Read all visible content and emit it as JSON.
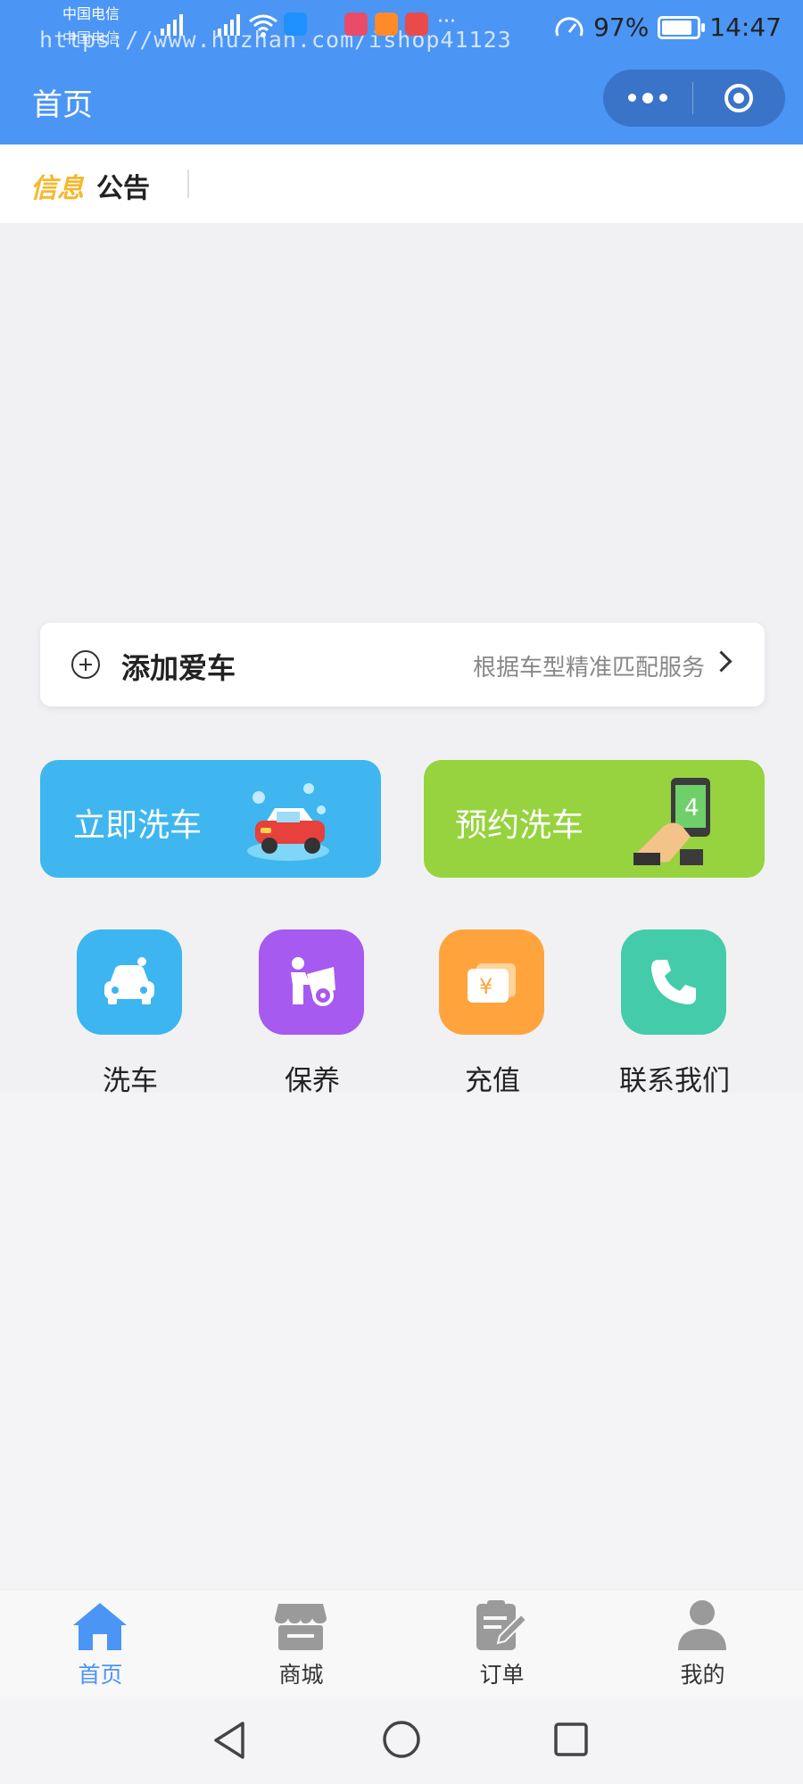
{
  "status_bar": {
    "carrier1": "中国电信",
    "carrier2": "中国电信",
    "watermark": "https://www.huzhan.com/ishop41123",
    "battery_percent": "97%",
    "battery_level": 0.97,
    "time": "14:47"
  },
  "header": {
    "title": "首页"
  },
  "notice": {
    "label_part1": "信息",
    "label_part2": "公告"
  },
  "add_car": {
    "title": "添加爱车",
    "hint": "根据车型精准匹配服务"
  },
  "actions": [
    {
      "label": "立即洗车",
      "color": "#3fb6ef"
    },
    {
      "label": "预约洗车",
      "color": "#96d33f"
    }
  ],
  "grid": [
    {
      "label": "洗车",
      "icon": "car-icon",
      "color": "#3db5f0"
    },
    {
      "label": "保养",
      "icon": "maintenance-icon",
      "color": "#a65af0"
    },
    {
      "label": "充值",
      "icon": "wallet-icon",
      "color": "#ffa43d"
    },
    {
      "label": "联系我们",
      "icon": "phone-icon",
      "color": "#44ccaa"
    }
  ],
  "tabs": [
    {
      "label": "首页",
      "icon": "home-icon",
      "active": true
    },
    {
      "label": "商城",
      "icon": "store-icon",
      "active": false
    },
    {
      "label": "订单",
      "icon": "order-icon",
      "active": false
    },
    {
      "label": "我的",
      "icon": "user-icon",
      "active": false
    }
  ],
  "colors": {
    "brand": "#4b95f5",
    "tab_inactive": "#9a9a9a"
  }
}
